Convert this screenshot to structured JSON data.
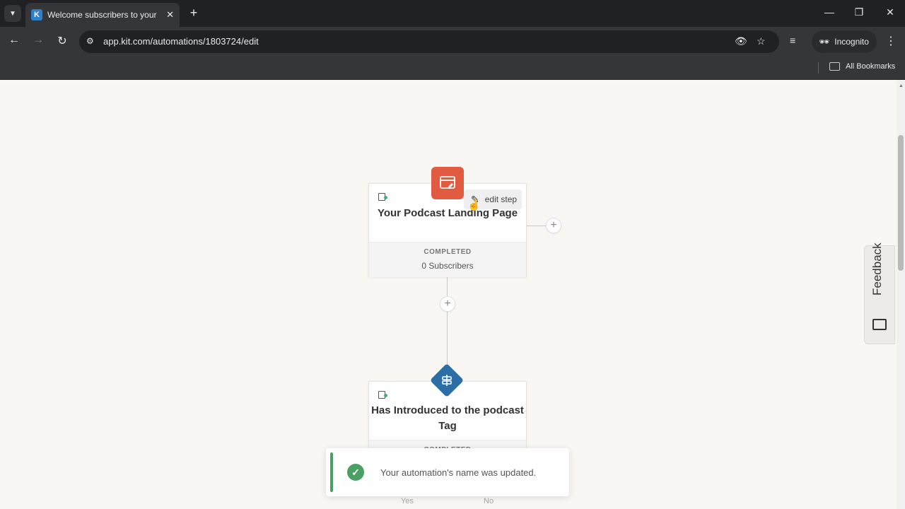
{
  "browser": {
    "tab_title": "Welcome subscribers to your p",
    "tab_favicon_letter": "K",
    "url": "app.kit.com/automations/1803724/edit",
    "profile_label": "Incognito",
    "bookmarks_label": "All Bookmarks"
  },
  "flow": {
    "steps": [
      {
        "title": "Your Podcast Landing Page",
        "status": "COMPLETED",
        "subscribers": "0 Subscribers",
        "icon": "landing-page-icon"
      },
      {
        "title": "Has Introduced to the podcast Tag",
        "status": "COMPLETED",
        "icon": "tag-condition-icon"
      }
    ],
    "edit_step_label": "edit step",
    "branch_yes": "Yes",
    "branch_no": "No"
  },
  "feedback": {
    "label": "Feedback"
  },
  "toast": {
    "message": "Your automation's name was updated."
  },
  "colors": {
    "landing_icon": "#e05b3f",
    "tag_icon": "#2c6fa6",
    "success": "#4aa063"
  }
}
